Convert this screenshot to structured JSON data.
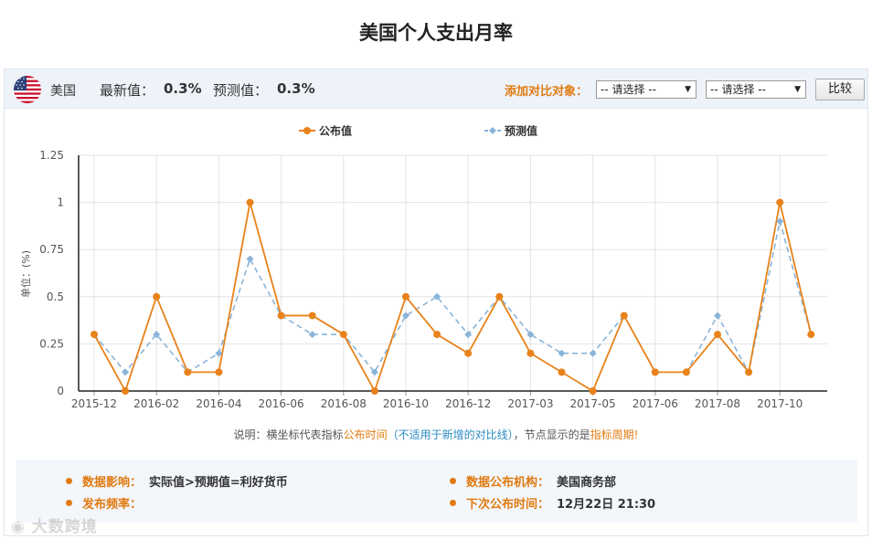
{
  "page": {
    "title": "美国个人支出月率"
  },
  "header": {
    "country": "美国",
    "flag_icon": "us-flag-icon",
    "latest_label": "最新值：",
    "latest_value": "0.3%",
    "forecast_label": "预测值：",
    "forecast_value": "0.3%",
    "compare_label": "添加对比对象：",
    "select_1": "-- 请选择 --",
    "select_2": "-- 请选择 --",
    "compare_button": "比较"
  },
  "colors": {
    "published": "#e8821a",
    "forecast": "#8ab4d9",
    "grid": "#e3e3e3",
    "axis": "#222222"
  },
  "chart_data": {
    "type": "line",
    "ylabel": "单位：(%)",
    "ylim": [
      0,
      1.25
    ],
    "yticks": [
      "0",
      "0.25",
      "0.5",
      "0.75",
      "1",
      "1.25"
    ],
    "xtick_labels": [
      "2015-12",
      "2016-02",
      "2016-04",
      "2016-06",
      "2016-08",
      "2016-10",
      "2016-12",
      "2017-03",
      "2017-05",
      "2017-06",
      "2017-08",
      "2017-10"
    ],
    "legend": [
      "公布值",
      "预测值"
    ],
    "legend_position": "top-center",
    "grid": true,
    "series": [
      {
        "name": "公布值",
        "values": [
          0.3,
          0.0,
          0.5,
          0.1,
          0.1,
          1.0,
          0.4,
          0.4,
          0.3,
          0.0,
          0.5,
          0.3,
          0.2,
          0.5,
          0.2,
          0.1,
          0.0,
          0.4,
          0.1,
          0.1,
          0.3,
          0.1,
          1.0,
          0.3
        ]
      },
      {
        "name": "预测值",
        "values": [
          0.3,
          0.1,
          0.3,
          0.1,
          0.2,
          0.7,
          0.4,
          0.3,
          0.3,
          0.1,
          0.4,
          0.5,
          0.3,
          0.5,
          0.3,
          0.2,
          0.2,
          0.4,
          0.1,
          0.1,
          0.4,
          0.1,
          0.9,
          0.3
        ]
      }
    ]
  },
  "note": {
    "prefix": "说明：横坐标代表指标",
    "time": "公布时间",
    "paren": "（不适用于新增的对比线）",
    "mid": "，节点显示的是",
    "period": "指标周期",
    "end": "!"
  },
  "info": {
    "impact_label": "数据影响：",
    "impact_value": "实际值>预期值=利好货币",
    "agency_label": "数据公布机构：",
    "agency_value": "美国商务部",
    "freq_label": "发布频率：",
    "freq_value": "",
    "next_label": "下次公布时间：",
    "next_value": "12月22日 21:30"
  },
  "watermark": "大数跨境"
}
